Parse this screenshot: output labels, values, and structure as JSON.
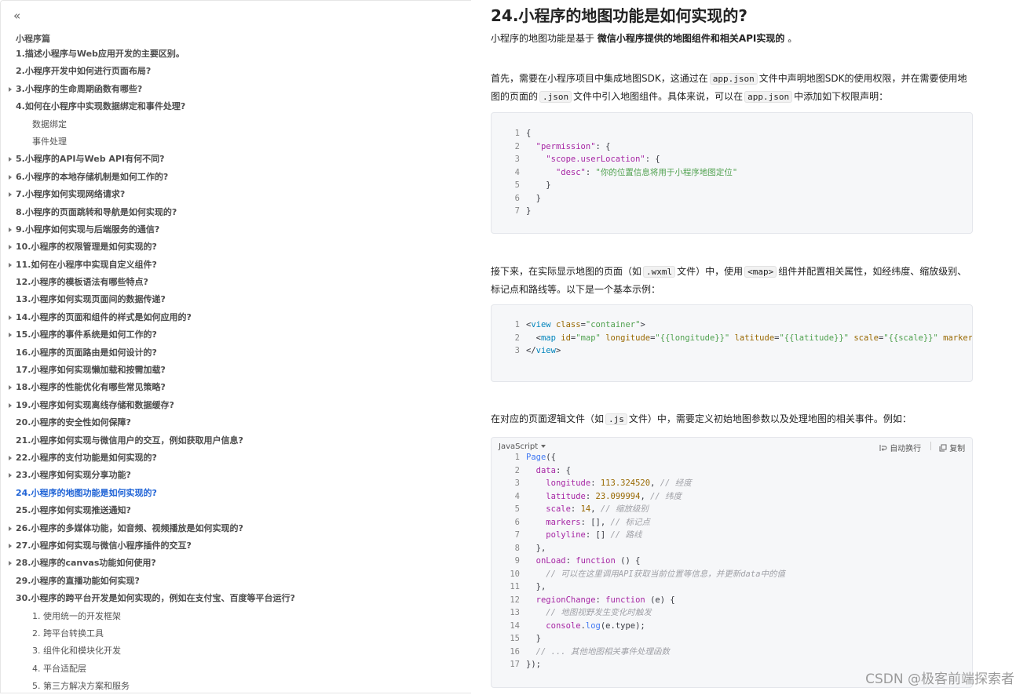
{
  "sidebar": {
    "collapse_icon": "«",
    "title": "小程序篇",
    "items": [
      {
        "label": "1.描述小程序与Web应用开发的主要区别。",
        "type": "main",
        "caret": false
      },
      {
        "label": "2.小程序开发中如何进行页面布局?",
        "type": "main",
        "caret": false
      },
      {
        "label": "3.小程序的生命周期函数有哪些?",
        "type": "main",
        "caret": true
      },
      {
        "label": "4.如何在小程序中实现数据绑定和事件处理?",
        "type": "main",
        "caret": false
      },
      {
        "label": "数据绑定",
        "type": "sub",
        "caret": false
      },
      {
        "label": "事件处理",
        "type": "sub",
        "caret": false
      },
      {
        "label": "5.小程序的API与Web API有何不同?",
        "type": "main",
        "caret": true
      },
      {
        "label": "6.小程序的本地存储机制是如何工作的?",
        "type": "main",
        "caret": true
      },
      {
        "label": "7.小程序如何实现网络请求?",
        "type": "main",
        "caret": true
      },
      {
        "label": "8.小程序的页面跳转和导航是如何实现的?",
        "type": "main",
        "caret": false
      },
      {
        "label": "9.小程序如何实现与后端服务的通信?",
        "type": "main",
        "caret": true
      },
      {
        "label": "10.小程序的权限管理是如何实现的?",
        "type": "main",
        "caret": true
      },
      {
        "label": "11.如何在小程序中实现自定义组件?",
        "type": "main",
        "caret": true
      },
      {
        "label": "12.小程序的模板语法有哪些特点?",
        "type": "main",
        "caret": false
      },
      {
        "label": "13.小程序如何实现页面间的数据传递?",
        "type": "main",
        "caret": false
      },
      {
        "label": "14.小程序的页面和组件的样式是如何应用的?",
        "type": "main",
        "caret": true
      },
      {
        "label": "15.小程序的事件系统是如何工作的?",
        "type": "main",
        "caret": true
      },
      {
        "label": "16.小程序的页面路由是如何设计的?",
        "type": "main",
        "caret": false
      },
      {
        "label": "17.小程序如何实现懒加载和按需加载?",
        "type": "main",
        "caret": false
      },
      {
        "label": "18.小程序的性能优化有哪些常见策略?",
        "type": "main",
        "caret": true
      },
      {
        "label": "19.小程序如何实现离线存储和数据缓存?",
        "type": "main",
        "caret": true
      },
      {
        "label": "20.小程序的安全性如何保障?",
        "type": "main",
        "caret": false
      },
      {
        "label": "21.小程序如何实现与微信用户的交互，例如获取用户信息?",
        "type": "main",
        "caret": false
      },
      {
        "label": "22.小程序的支付功能是如何实现的?",
        "type": "main",
        "caret": true
      },
      {
        "label": "23.小程序如何实现分享功能?",
        "type": "main",
        "caret": true
      },
      {
        "label": "24.小程序的地图功能是如何实现的?",
        "type": "main",
        "caret": false,
        "active": true
      },
      {
        "label": "25.小程序如何实现推送通知?",
        "type": "main",
        "caret": false
      },
      {
        "label": "26.小程序的多媒体功能，如音频、视频播放是如何实现的?",
        "type": "main",
        "caret": true
      },
      {
        "label": "27.小程序如何实现与微信小程序插件的交互?",
        "type": "main",
        "caret": true
      },
      {
        "label": "28.小程序的canvas功能如何使用?",
        "type": "main",
        "caret": true
      },
      {
        "label": "29.小程序的直播功能如何实现?",
        "type": "main",
        "caret": false
      },
      {
        "label": "30.小程序的跨平台开发是如何实现的，例如在支付宝、百度等平台运行?",
        "type": "main",
        "caret": false
      },
      {
        "label": "1. 使用统一的开发框架",
        "type": "sub",
        "caret": false
      },
      {
        "label": "2. 跨平台转换工具",
        "type": "sub",
        "caret": false
      },
      {
        "label": "3. 组件化和模块化开发",
        "type": "sub",
        "caret": false
      },
      {
        "label": "4. 平台适配层",
        "type": "sub",
        "caret": false
      },
      {
        "label": "5. 第三方解决方案和服务",
        "type": "sub",
        "caret": false
      }
    ]
  },
  "article": {
    "title": "24.小程序的地图功能是如何实现的?",
    "intro_prefix": "小程序的地图功能是基于 ",
    "intro_bold": "微信小程序提供的地图组件和相关API实现的",
    "intro_suffix": " 。",
    "p1": [
      "首先，需要在小程序项目中集成地图SDK，这通过在",
      "app.json",
      "文件中声明地图SDK的使用权限，并在需要使用地图的页面的",
      ".json",
      "文件中引入地图组件。具体来说，可以在",
      "app.json",
      "中添加如下权限声明："
    ],
    "p2": [
      "接下来，在实际显示地图的页面（如",
      ".wxml",
      "文件）中，使用",
      "<map>",
      "组件并配置相关属性，如经纬度、缩放级别、标记点和路线等。以下是一个基本示例："
    ],
    "p3": [
      "在对应的页面逻辑文件（如",
      ".js",
      "文件）中，需要定义初始地图参数以及处理地图的相关事件。例如："
    ]
  },
  "code1": [
    [
      [
        "plain",
        "{"
      ]
    ],
    [
      [
        "plain",
        "  "
      ],
      [
        "key",
        "\"permission\""
      ],
      [
        "plain",
        ": {"
      ]
    ],
    [
      [
        "plain",
        "    "
      ],
      [
        "key",
        "\"scope.userLocation\""
      ],
      [
        "plain",
        ": {"
      ]
    ],
    [
      [
        "plain",
        "      "
      ],
      [
        "key",
        "\"desc\""
      ],
      [
        "plain",
        ": "
      ],
      [
        "str",
        "\"你的位置信息将用于小程序地图定位\""
      ]
    ],
    [
      [
        "plain",
        "    }"
      ]
    ],
    [
      [
        "plain",
        "  }"
      ]
    ],
    [
      [
        "plain",
        "}"
      ]
    ]
  ],
  "code2": [
    [
      [
        "plain",
        "<"
      ],
      [
        "tag",
        "view"
      ],
      [
        "plain",
        " "
      ],
      [
        "attr",
        "class"
      ],
      [
        "plain",
        "="
      ],
      [
        "str",
        "\"container\""
      ],
      [
        "plain",
        ">"
      ]
    ],
    [
      [
        "plain",
        "  <"
      ],
      [
        "tag",
        "map"
      ],
      [
        "plain",
        " "
      ],
      [
        "attr",
        "id"
      ],
      [
        "plain",
        "="
      ],
      [
        "str",
        "\"map\""
      ],
      [
        "plain",
        " "
      ],
      [
        "attr",
        "longitude"
      ],
      [
        "plain",
        "="
      ],
      [
        "str",
        "\"{{longitude}}\""
      ],
      [
        "plain",
        " "
      ],
      [
        "attr",
        "latitude"
      ],
      [
        "plain",
        "="
      ],
      [
        "str",
        "\"{{latitude}}\""
      ],
      [
        "plain",
        " "
      ],
      [
        "attr",
        "scale"
      ],
      [
        "plain",
        "="
      ],
      [
        "str",
        "\"{{scale}}\""
      ],
      [
        "plain",
        " "
      ],
      [
        "attr",
        "markers"
      ],
      [
        "plain",
        "=\""
      ]
    ],
    [
      [
        "plain",
        "</"
      ],
      [
        "tag",
        "view"
      ],
      [
        "plain",
        ">"
      ]
    ]
  ],
  "code3_toolbar": {
    "language": "JavaScript",
    "wrap_label": "自动换行",
    "copy_label": "复制",
    "wrap_icon": "wrap-icon",
    "copy_icon": "copy-icon"
  },
  "code3": [
    [
      [
        "fn",
        "Page"
      ],
      [
        "plain",
        "({"
      ]
    ],
    [
      [
        "plain",
        "  "
      ],
      [
        "key",
        "data"
      ],
      [
        "plain",
        ": {"
      ]
    ],
    [
      [
        "plain",
        "    "
      ],
      [
        "key",
        "longitude"
      ],
      [
        "plain",
        ": "
      ],
      [
        "num",
        "113.324520"
      ],
      [
        "plain",
        ", "
      ],
      [
        "com",
        "// 经度"
      ]
    ],
    [
      [
        "plain",
        "    "
      ],
      [
        "key",
        "latitude"
      ],
      [
        "plain",
        ": "
      ],
      [
        "num",
        "23.099994"
      ],
      [
        "plain",
        ", "
      ],
      [
        "com",
        "// 纬度"
      ]
    ],
    [
      [
        "plain",
        "    "
      ],
      [
        "key",
        "scale"
      ],
      [
        "plain",
        ": "
      ],
      [
        "num",
        "14"
      ],
      [
        "plain",
        ", "
      ],
      [
        "com",
        "// 缩放级别"
      ]
    ],
    [
      [
        "plain",
        "    "
      ],
      [
        "key",
        "markers"
      ],
      [
        "plain",
        ": [], "
      ],
      [
        "com",
        "// 标记点"
      ]
    ],
    [
      [
        "plain",
        "    "
      ],
      [
        "key",
        "polyline"
      ],
      [
        "plain",
        ": [] "
      ],
      [
        "com",
        "// 路线"
      ]
    ],
    [
      [
        "plain",
        "  },"
      ]
    ],
    [
      [
        "plain",
        "  "
      ],
      [
        "key",
        "onLoad"
      ],
      [
        "plain",
        ": "
      ],
      [
        "kw",
        "function"
      ],
      [
        "plain",
        " () {"
      ]
    ],
    [
      [
        "plain",
        "    "
      ],
      [
        "com",
        "// 可以在这里调用API获取当前位置等信息，并更新data中的值"
      ]
    ],
    [
      [
        "plain",
        "  },"
      ]
    ],
    [
      [
        "plain",
        "  "
      ],
      [
        "key",
        "regionChange"
      ],
      [
        "plain",
        ": "
      ],
      [
        "kw",
        "function"
      ],
      [
        "plain",
        " (e) {"
      ]
    ],
    [
      [
        "plain",
        "    "
      ],
      [
        "com",
        "// 地图视野发生变化时触发"
      ]
    ],
    [
      [
        "plain",
        "    "
      ],
      [
        "key",
        "console"
      ],
      [
        "plain",
        "."
      ],
      [
        "fn",
        "log"
      ],
      [
        "plain",
        "(e.type);"
      ]
    ],
    [
      [
        "plain",
        "  }"
      ]
    ],
    [
      [
        "plain",
        "  "
      ],
      [
        "com",
        "// ... 其他地图相关事件处理函数"
      ]
    ],
    [
      [
        "plain",
        "});"
      ]
    ]
  ],
  "watermark": "CSDN @极客前端探索者"
}
